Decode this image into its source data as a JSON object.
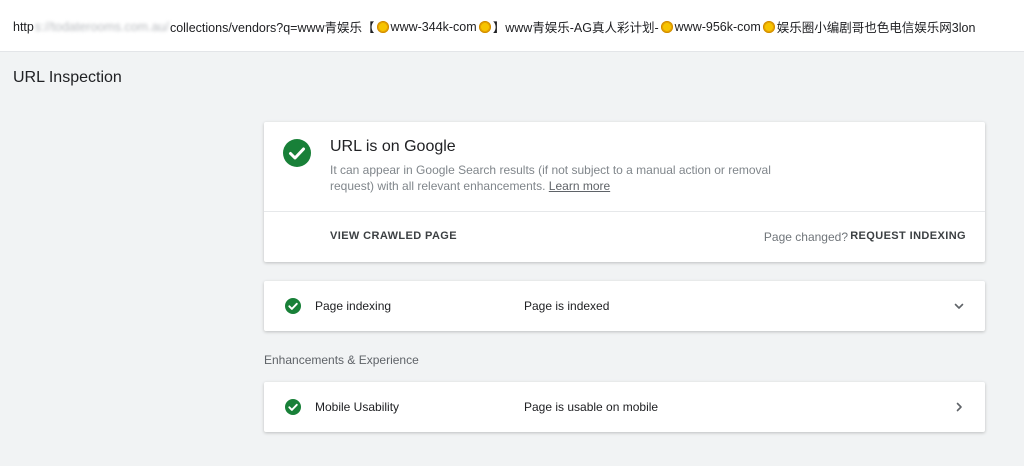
{
  "url_bar": {
    "prefix": "http",
    "blurred": "s://todaterooms.com.au/",
    "path_start": "collections/vendors?q=www青娱乐【",
    "seg1": "www-344k-com",
    "seg2": "】www青娱乐-AG真人彩计划-",
    "seg3": "www-956k-com",
    "seg4": "娱乐圈小编剧哥也色电信娱乐网3lon"
  },
  "page_title": "URL Inspection",
  "status_card": {
    "title": "URL is on Google",
    "description": "It can appear in Google Search results (if not subject to a manual action or removal request) with all relevant enhancements.",
    "learn_more": "Learn more",
    "view_crawled": "VIEW CRAWLED PAGE",
    "page_changed": "Page changed?",
    "request_indexing": "REQUEST INDEXING"
  },
  "indexing": {
    "label": "Page indexing",
    "value": "Page is indexed"
  },
  "enhancements_heading": "Enhancements & Experience",
  "mobile": {
    "label": "Mobile Usability",
    "value": "Page is usable on mobile"
  },
  "colors": {
    "success": "#188038",
    "bg": "#f1f3f4"
  }
}
